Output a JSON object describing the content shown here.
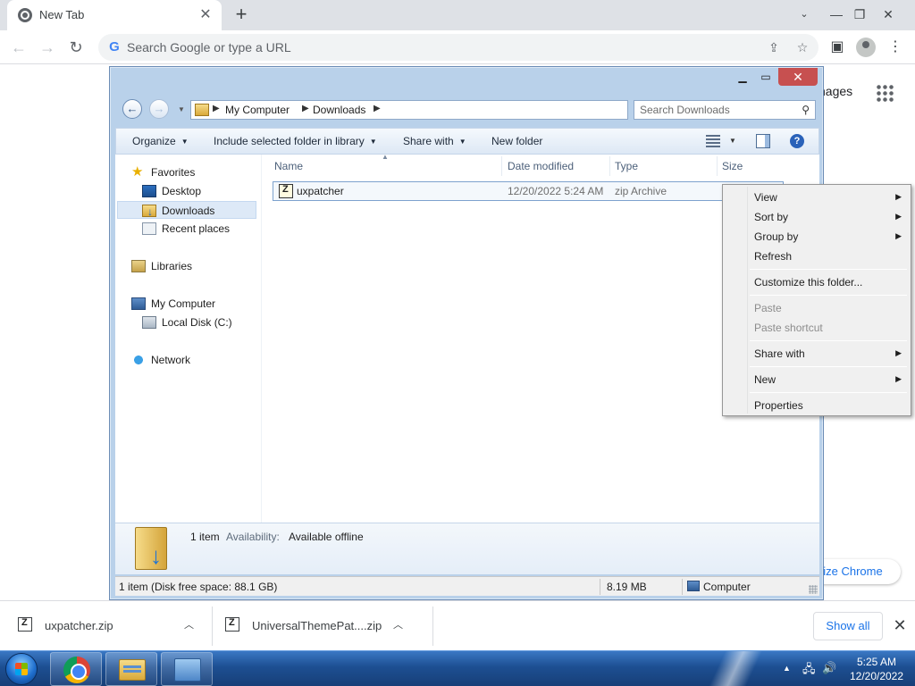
{
  "browser": {
    "tab_title": "New Tab",
    "omnibox_placeholder": "Search Google or type a URL",
    "ntp_images_text": "nages",
    "customize_text": "nize Chrome"
  },
  "downloads": {
    "items": [
      {
        "name": "uxpatcher.zip"
      },
      {
        "name": "UniversalThemePat....zip"
      }
    ],
    "show_all": "Show all"
  },
  "explorer": {
    "breadcrumb": [
      "My Computer",
      "Downloads"
    ],
    "search_placeholder": "Search Downloads",
    "commands": {
      "organize": "Organize",
      "include_library": "Include selected folder in library",
      "share_with": "Share with",
      "new_folder": "New folder"
    },
    "nav": {
      "favorites": "Favorites",
      "desktop": "Desktop",
      "downloads": "Downloads",
      "recent_places": "Recent places",
      "libraries": "Libraries",
      "my_computer": "My Computer",
      "local_disk": "Local Disk (C:)",
      "network": "Network"
    },
    "columns": {
      "name": "Name",
      "date_modified": "Date modified",
      "type": "Type",
      "size": "Size"
    },
    "files": [
      {
        "name": "uxpatcher",
        "date_modified": "12/20/2022 5:24 AM",
        "type": "zip Archive"
      }
    ],
    "details": {
      "count": "1 item",
      "availability_label": "Availability:",
      "availability_value": "Available offline"
    },
    "status": {
      "summary": "1 item (Disk free space: 88.1 GB)",
      "size": "8.19 MB",
      "location": "Computer"
    }
  },
  "context_menu": {
    "view": "View",
    "sort_by": "Sort by",
    "group_by": "Group by",
    "refresh": "Refresh",
    "customize": "Customize this folder...",
    "paste": "Paste",
    "paste_shortcut": "Paste shortcut",
    "share_with": "Share with",
    "new": "New",
    "properties": "Properties"
  },
  "taskbar": {
    "time": "5:25 AM",
    "date": "12/20/2022"
  },
  "colors": {
    "explorer_frame": "#b9d1ea",
    "close_button": "#c75050",
    "taskbar": "#1d4f92",
    "chrome_link": "#1a73e8"
  }
}
